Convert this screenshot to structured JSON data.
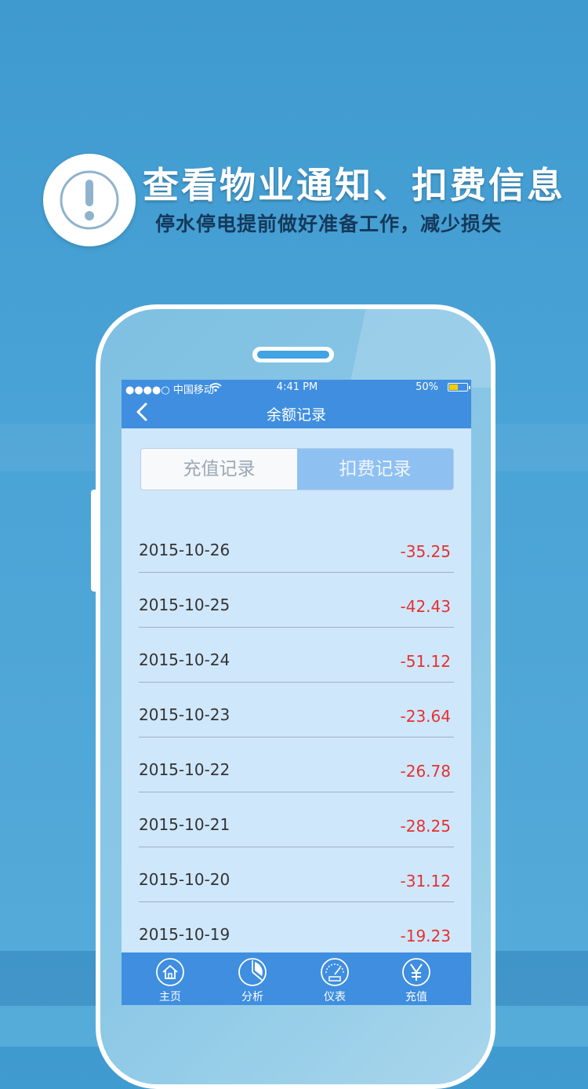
{
  "promo": {
    "title": "查看物业通知、扣费信息",
    "subtitle": "停水停电提前做好准备工作，减少损失",
    "badge_icon": "exclamation-icon"
  },
  "status_bar": {
    "carrier": "●●●●○ 中国移动",
    "time": "4:41 PM",
    "battery_percent": "50%",
    "battery_level": 0.5
  },
  "nav": {
    "title": "余额记录",
    "back_icon": "chevron-left-icon"
  },
  "segments": {
    "recharge_label": "充值记录",
    "deduct_label": "扣费记录",
    "selected": "扣费记录"
  },
  "records": [
    {
      "date": "2015-10-26",
      "amount": "-35.25"
    },
    {
      "date": "2015-10-25",
      "amount": "-42.43"
    },
    {
      "date": "2015-10-24",
      "amount": "-51.12"
    },
    {
      "date": "2015-10-23",
      "amount": "-23.64"
    },
    {
      "date": "2015-10-22",
      "amount": "-26.78"
    },
    {
      "date": "2015-10-21",
      "amount": "-28.25"
    },
    {
      "date": "2015-10-20",
      "amount": "-31.12"
    },
    {
      "date": "2015-10-19",
      "amount": "-19.23"
    }
  ],
  "tabbar": {
    "items": [
      {
        "label": "主页",
        "icon": "home-icon"
      },
      {
        "label": "分析",
        "icon": "pie-chart-icon"
      },
      {
        "label": "仪表",
        "icon": "gauge-icon"
      },
      {
        "label": "充值",
        "icon": "yen-icon"
      }
    ]
  },
  "colors": {
    "background": "#4aa3d6",
    "nav_bar": "#3f8ee0",
    "screen_bg": "#cfe7fb",
    "amount_red": "#e4312f",
    "selected_segment": "#8ec0f2"
  }
}
